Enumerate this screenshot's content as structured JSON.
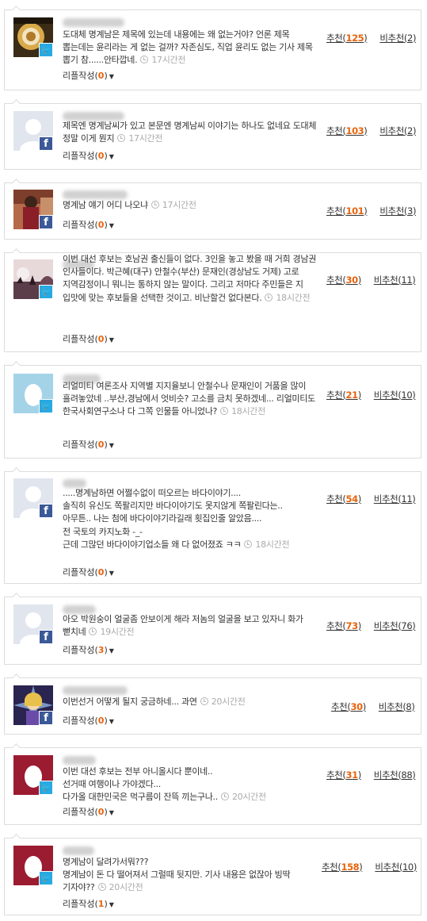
{
  "comments": [
    {
      "sns": "twitter",
      "avatar": "photo-cup",
      "text": "도대체 명계남은 제목에 있는데 내용에는 왜 없는거야? 언론 제목 뽑는데는 윤리라는 게 없는 걸까? 자존심도, 직업 윤리도 없는 기사 제목 뽑기 참......안타깝네.",
      "time": "17시간전",
      "reply_label": "리플작성",
      "reply_count": "0",
      "up_label": "추천",
      "up": "125",
      "down_label": "비추천",
      "down": "2"
    },
    {
      "sns": "facebook",
      "avatar": "default-silhouette",
      "text": "제목엔 명계남씨가 있고 본문엔 명계남씨 이야기는 하나도 없네요 도대체 정말 이게 뭔지",
      "time": "17시간전",
      "reply_label": "리플작성",
      "reply_count": "0",
      "up_label": "추천",
      "up": "103",
      "down_label": "비추천",
      "down": "2"
    },
    {
      "sns": "facebook",
      "avatar": "photo-person",
      "text": "명계남 얘기 어디 나오냐",
      "time": "17시간전",
      "reply_label": "리플작성",
      "reply_count": "0",
      "up_label": "추천",
      "up": "101",
      "down_label": "비추천",
      "down": "3"
    },
    {
      "sns": "twitter",
      "avatar": "photo-sunset",
      "text": "이번 대선 후보는 호남권 출신들이 없다. 3인을 놓고 봤을 때 거희 경남권 인사들이다. 박근혜(대구) 안철수(부산) 문재인(경상남도 거제) 고로 지역감정이니 뭐니는 통하지 않는 말이다. 그리고 저마다 주민들은 지 입맛에 맞는 후보들을 선택한 것이고. 비난할건 없다본다.",
      "time": "18시간전",
      "reply_label": "리플작성",
      "reply_count": "0",
      "up_label": "추천",
      "up": "30",
      "down_label": "비추천",
      "down": "11"
    },
    {
      "sns": "twitter",
      "avatar": "twitter-egg",
      "text": "리얼미티 여론조사 지역별 지지율보니 안철수나 문재인이 거품을 많이 흘려놓았네 ..부산,경남에서 엇비슷? 고소를 금치 못하겠네... 리얼미티도 한국사회연구소나 다 그쪽 인물들 아니었나?",
      "time": "18시간전",
      "reply_label": "리플작성",
      "reply_count": "0",
      "up_label": "추천",
      "up": "21",
      "down_label": "비추천",
      "down": "10"
    },
    {
      "sns": "facebook",
      "avatar": "default-silhouette",
      "lines": [
        ".....명계남하면 어쩔수없이 떠오르는 바다이야기....",
        "솔직히 유신도 쪽팔리지만 바다이야기도 못지않게 쪽팔린다는..",
        "아무튼.. 나는 첨에 바다이야기라길래 횟집인줄 알았음....",
        "전 국토의 카지노화 -_-",
        "근데 그많던 바다이야기업소들 왜 다 없어졌죠 ㅋㅋ"
      ],
      "time": "18시간전",
      "reply_label": "리플작성",
      "reply_count": "0",
      "up_label": "추천",
      "up": "54",
      "down_label": "비추천",
      "down": "11"
    },
    {
      "sns": "facebook",
      "avatar": "default-silhouette",
      "text": "아오 박원숭이 얼굴좀 안보이게 해라 저놈의 얼굴을 보고 있자니 화가 뻗치네",
      "time": "19시간전",
      "reply_label": "리플작성",
      "reply_count": "3",
      "up_label": "추천",
      "up": "73",
      "down_label": "비추천",
      "down": "76"
    },
    {
      "sns": "facebook",
      "avatar": "photo-anime",
      "text": "이번선거 어떻게 될지 궁금하네... 과연",
      "time": "20시간전",
      "reply_label": "리플작성",
      "reply_count": "0",
      "up_label": "추천",
      "up": "30",
      "down_label": "비추천",
      "down": "8"
    },
    {
      "sns": "twitter",
      "avatar": "twitter-egg-red",
      "lines": [
        "이번 대선 후보는 전부 아니올시다 뿐이네..",
        "선거때 여행이나 가야겠다...",
        "다가올 대한민국은 먹구름이 잔뜩 끼는구나.."
      ],
      "time": "20시간전",
      "reply_label": "리플작성",
      "reply_count": "0",
      "up_label": "추천",
      "up": "31",
      "down_label": "비추천",
      "down": "88"
    },
    {
      "sns": "twitter",
      "avatar": "twitter-egg-red",
      "lines": [
        "명계남이 달려가서뭐???",
        "명계남이 돈 다 떨어져서 그럴때 뒷지만. 기사 내용은 없잖아 빙딱 기자야??"
      ],
      "time": "20시간전",
      "reply_label": "리플작성",
      "reply_count": "1",
      "up_label": "추천",
      "up": "158",
      "down_label": "비추천",
      "down": "10"
    }
  ]
}
